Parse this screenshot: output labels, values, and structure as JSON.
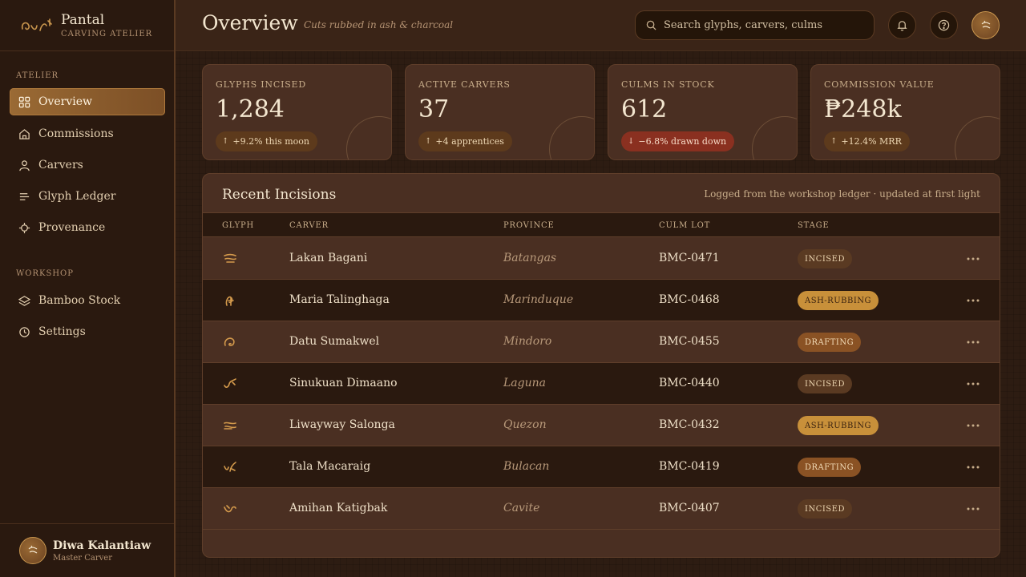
{
  "brand": {
    "name": "Pantal",
    "subtitle": "CARVING ATELIER"
  },
  "sidebar": {
    "sections": [
      {
        "title": "ATELIER",
        "items": [
          {
            "label": "Overview",
            "icon": "grid-icon",
            "active": true
          },
          {
            "label": "Commissions",
            "icon": "home-icon",
            "active": false
          },
          {
            "label": "Carvers",
            "icon": "user-icon",
            "active": false
          },
          {
            "label": "Glyph Ledger",
            "icon": "list-icon",
            "active": false
          },
          {
            "label": "Provenance",
            "icon": "crosshair-icon",
            "active": false
          }
        ]
      },
      {
        "title": "WORKSHOP",
        "items": [
          {
            "label": "Bamboo Stock",
            "icon": "layers-icon",
            "active": false
          },
          {
            "label": "Settings",
            "icon": "clock-icon",
            "active": false
          }
        ]
      }
    ],
    "user": {
      "name": "Diwa Kalantiaw",
      "role": "Master Carver"
    }
  },
  "header": {
    "title": "Overview",
    "subtitle": "Cuts rubbed in ash & charcoal",
    "search_placeholder": "Search glyphs, carvers, culms"
  },
  "stats": [
    {
      "label": "GLYPHS INCISED",
      "value": "1,284",
      "delta": "+9.2% this moon",
      "direction": "up"
    },
    {
      "label": "ACTIVE CARVERS",
      "value": "37",
      "delta": "+4 apprentices",
      "direction": "up"
    },
    {
      "label": "CULMS IN STOCK",
      "value": "612",
      "delta": "−6.8% drawn down",
      "direction": "down"
    },
    {
      "label": "COMMISSION VALUE",
      "value": "₱248k",
      "delta": "+12.4% MRR",
      "direction": "up"
    }
  ],
  "table": {
    "title": "Recent Incisions",
    "note": "Logged from the workshop ledger · updated at first light",
    "columns": [
      "GLYPH",
      "CARVER",
      "PROVINCE",
      "CULM LOT",
      "STAGE"
    ],
    "rows": [
      {
        "glyph": "baybayin-glyph-icon",
        "carver": "Lakan Bagani",
        "province": "Batangas",
        "lot": "BMC-0471",
        "stage": "INCISED"
      },
      {
        "glyph": "baybayin-glyph-icon",
        "carver": "Maria Talinghaga",
        "province": "Marinduque",
        "lot": "BMC-0468",
        "stage": "ASH-RUBBING"
      },
      {
        "glyph": "baybayin-glyph-icon",
        "carver": "Datu Sumakwel",
        "province": "Mindoro",
        "lot": "BMC-0455",
        "stage": "DRAFTING"
      },
      {
        "glyph": "baybayin-glyph-icon",
        "carver": "Sinukuan Dimaano",
        "province": "Laguna",
        "lot": "BMC-0440",
        "stage": "INCISED"
      },
      {
        "glyph": "baybayin-glyph-icon",
        "carver": "Liwayway Salonga",
        "province": "Quezon",
        "lot": "BMC-0432",
        "stage": "ASH-RUBBING"
      },
      {
        "glyph": "baybayin-glyph-icon",
        "carver": "Tala Macaraig",
        "province": "Bulacan",
        "lot": "BMC-0419",
        "stage": "DRAFTING"
      },
      {
        "glyph": "baybayin-glyph-icon",
        "carver": "Amihan Katigbak",
        "province": "Cavite",
        "lot": "BMC-0407",
        "stage": "INCISED"
      }
    ]
  },
  "colors": {
    "accent": "#c9964e",
    "active_nav": "#8a5c2c",
    "down": "#8a3020"
  }
}
